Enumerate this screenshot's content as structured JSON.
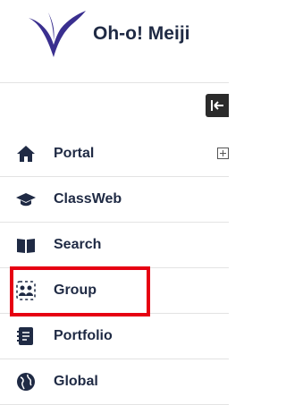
{
  "header": {
    "brand": "Oh-o! Meiji"
  },
  "collapse_button": {
    "icon": "collapse-left-icon"
  },
  "nav": {
    "items": [
      {
        "label": "Portal",
        "icon": "home-icon",
        "expandable": true
      },
      {
        "label": "ClassWeb",
        "icon": "graduation-cap-icon"
      },
      {
        "label": "Search",
        "icon": "book-icon"
      },
      {
        "label": "Group",
        "icon": "group-icon"
      },
      {
        "label": "Portfolio",
        "icon": "portfolio-icon"
      },
      {
        "label": "Global",
        "icon": "globe-icon"
      }
    ]
  },
  "colors": {
    "navy": "#1f2a44",
    "highlight": "#e60012",
    "logo": "#3a2f8f"
  }
}
